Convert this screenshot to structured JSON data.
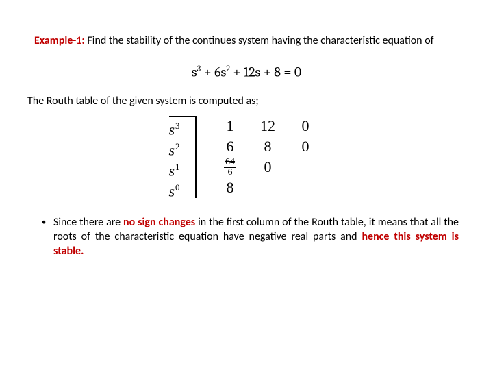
{
  "header": {
    "example_label": "Example-1:",
    "prompt_text": " Find the stability of the continues system having the characteristic equation of"
  },
  "equation": {
    "terms": [
      "s",
      "3",
      " + 6s",
      "2",
      " + 12s + 8 = 0"
    ]
  },
  "routh_intro": "The Routh table of the given system is computed as;",
  "routh": {
    "labels": [
      {
        "base": "s",
        "exp": "3"
      },
      {
        "base": "s",
        "exp": "2"
      },
      {
        "base": "s",
        "exp": "1"
      },
      {
        "base": "s",
        "exp": "0"
      }
    ],
    "rows": [
      [
        "1",
        "12",
        "0"
      ],
      [
        "6",
        "8",
        "0"
      ],
      [
        {
          "frac": {
            "num": "64",
            "den": "6",
            "strike": true
          }
        },
        "0",
        ""
      ],
      [
        "8",
        "",
        ""
      ]
    ]
  },
  "conclusion": {
    "pre": "Since there are ",
    "emph1": "no sign changes",
    "mid": " in the first column of the Routh table, it means that all the roots of the characteristic equation have negative real parts and ",
    "emph2": "hence this system is stable.",
    "post": ""
  }
}
